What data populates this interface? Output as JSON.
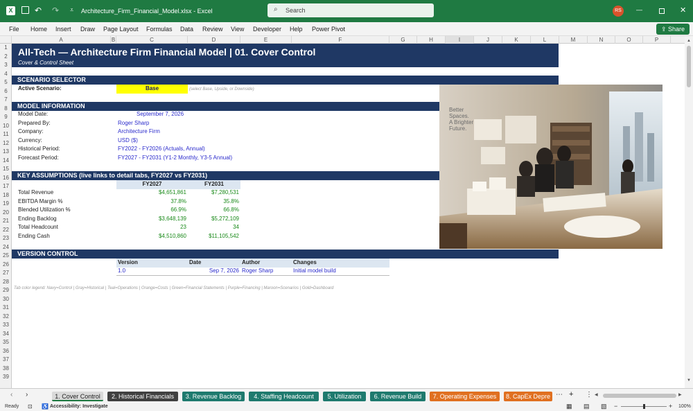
{
  "window": {
    "filename": "Architecture_Firm_Financial_Model.xlsx",
    "app": "Excel",
    "separator": "-",
    "search_placeholder": "Search",
    "avatar": "RS"
  },
  "ribbon": {
    "tabs": [
      "File",
      "Home",
      "Insert",
      "Draw",
      "Page Layout",
      "Formulas",
      "Data",
      "Review",
      "View",
      "Developer",
      "Help",
      "Power Pivot"
    ],
    "share": "Share"
  },
  "columns": [
    "A",
    "B",
    "C",
    "D",
    "E",
    "F",
    "G",
    "H",
    "I",
    "J",
    "K",
    "L",
    "M",
    "N",
    "O",
    "P"
  ],
  "rows": [
    "1",
    "2",
    "3",
    "4",
    "5",
    "6",
    "7",
    "8",
    "9",
    "10",
    "11",
    "12",
    "13",
    "14",
    "15",
    "16",
    "17",
    "18",
    "19",
    "20",
    "21",
    "22",
    "23",
    "24",
    "25",
    "26",
    "27",
    "28",
    "29",
    "30",
    "31",
    "32",
    "33",
    "34",
    "35",
    "36",
    "37",
    "38",
    "39"
  ],
  "sheet": {
    "title": "All-Tech  —  Architecture Firm Financial Model  |  01. Cover Control",
    "subtitle": "Cover & Control Sheet",
    "scenario_header": "SCENARIO SELECTOR",
    "active_scenario_label": "Active Scenario:",
    "active_scenario_value": "Base",
    "scenario_hint": "(select Base, Upside, or Downside)",
    "model_info_header": "MODEL INFORMATION",
    "model_info": [
      {
        "label": "Model Date:",
        "value": "September 7, 2026"
      },
      {
        "label": "Prepared By:",
        "value": "Roger Sharp"
      },
      {
        "label": "Company:",
        "value": "Architecture Firm"
      },
      {
        "label": "Currency:",
        "value": "USD ($)"
      },
      {
        "label": "Historical Period:",
        "value": "FY2022 - FY2026 (Actuals, Annual)"
      },
      {
        "label": "Forecast Period:",
        "value": "FY2027 - FY2031 (Y1-2 Monthly, Y3-5 Annual)"
      }
    ],
    "assumptions_header": "KEY ASSUMPTIONS  (live links to detail tabs, FY2027 vs FY2031)",
    "assumptions_cols": [
      "FY2027",
      "FY2031"
    ],
    "assumptions": [
      {
        "label": "Total Revenue",
        "a": "$4,651,861",
        "b": "$7,280,531"
      },
      {
        "label": "EBITDA Margin %",
        "a": "37.8%",
        "b": "35.8%"
      },
      {
        "label": "Blended Utilization %",
        "a": "66.9%",
        "b": "66.8%"
      },
      {
        "label": "Ending Backlog",
        "a": "$3,648,139",
        "b": "$5,272,109"
      },
      {
        "label": "Total Headcount",
        "a": "23",
        "b": "34"
      },
      {
        "label": "Ending Cash",
        "a": "$4,510,860",
        "b": "$11,105,542"
      }
    ],
    "version_header": "VERSION CONTROL",
    "version_cols": [
      "Version",
      "Date",
      "Author",
      "Changes"
    ],
    "version_row": [
      "1.0",
      "Sep 7, 2026",
      "Roger Sharp",
      "Initial model build"
    ],
    "legend": "Tab color legend: Navy=Control | Gray=Historical | Teal=Operations | Orange=Costs | Green=Financial Statements | Purple=Financing | Maroon=Scenarios | Gold=Dashboard",
    "photo_sign": [
      "Better",
      "Spaces.",
      "A Brighter",
      "Future."
    ]
  },
  "tabs": [
    {
      "label": "1. Cover Control",
      "color": "#d9d9d9",
      "text": "#222"
    },
    {
      "label": "2. Historical Financials",
      "color": "#404040",
      "text": "#fff"
    },
    {
      "label": "3. Revenue Backlog",
      "color": "#1e7a6e",
      "text": "#fff"
    },
    {
      "label": "4. Staffing Headcount",
      "color": "#1e7a6e",
      "text": "#fff"
    },
    {
      "label": "5. Utilization",
      "color": "#1e7a6e",
      "text": "#fff"
    },
    {
      "label": "6. Revenue Build",
      "color": "#1e7a6e",
      "text": "#fff"
    },
    {
      "label": "7. Operating Expenses",
      "color": "#e07020",
      "text": "#fff"
    },
    {
      "label": "8. CapEx Depre",
      "color": "#e07020",
      "text": "#fff"
    }
  ],
  "status": {
    "ready": "Ready",
    "accessibility": "Accessibility: Investigate",
    "zoom": "100%"
  }
}
